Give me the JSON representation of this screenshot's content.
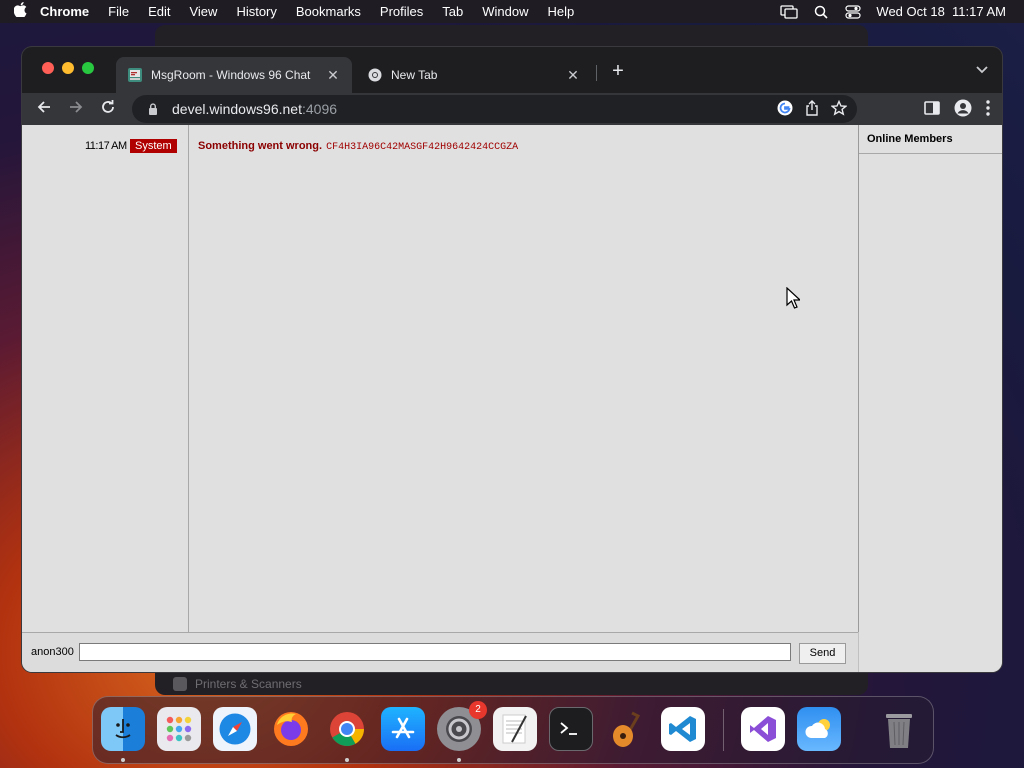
{
  "menubar": {
    "items": [
      "Chrome",
      "File",
      "Edit",
      "View",
      "History",
      "Bookmarks",
      "Profiles",
      "Tab",
      "Window",
      "Help"
    ],
    "datetime": "Wed Oct 18  11:17 AM"
  },
  "background_window": {
    "bottom_label": "Printers & Scanners"
  },
  "browser": {
    "tabs": [
      {
        "title": "MsgRoom - Windows 96 Chat",
        "active": true,
        "favicon": "msgroom-icon"
      },
      {
        "title": "New Tab",
        "active": false,
        "favicon": "chrome-icon"
      }
    ],
    "url": {
      "host": "devel.windows96.net",
      "port": ":4096"
    }
  },
  "chat": {
    "messages": [
      {
        "time": "11:17 AM",
        "user": "System",
        "text": "Something went wrong.",
        "code": "CF4H3IA96C42MASGF42H9642424CCGZA"
      }
    ],
    "nickname": "anon300",
    "input_value": "",
    "send_label": "Send"
  },
  "members": {
    "heading": "Online Members"
  },
  "dock": {
    "apps": [
      "finder",
      "launchpad",
      "safari",
      "firefox",
      "chrome",
      "app-store",
      "system-settings",
      "textedit",
      "terminal",
      "garageband",
      "vscode",
      "visual-studio",
      "weather",
      "trash"
    ],
    "settings_badge": "2"
  },
  "colors": {
    "system_badge": "#b00000",
    "error_text": "#8b0000",
    "chrome_dark": "#35363a"
  }
}
